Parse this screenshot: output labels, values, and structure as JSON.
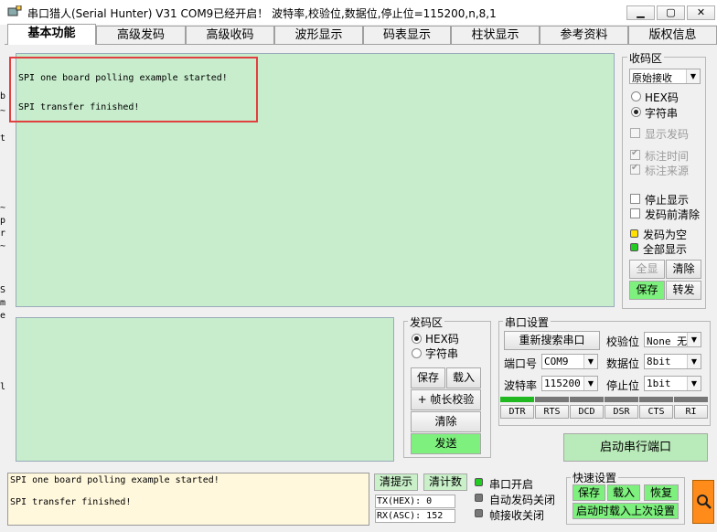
{
  "window": {
    "title": "串口猎人(Serial Hunter) V31    COM9已经开启！ 波特率,校验位,数据位,停止位=115200,n,8,1",
    "minimize": "▁",
    "maximize": "▢",
    "close": "✕"
  },
  "tabs": [
    "基本功能",
    "高级发码",
    "高级收码",
    "波形显示",
    "码表显示",
    "柱状显示",
    "参考资料",
    "版权信息"
  ],
  "receive": {
    "lines": [
      "SPI one board polling example started!",
      "SPI transfer finished!"
    ]
  },
  "left_edge_chars": [
    "b",
    "~",
    "t",
    "~",
    "p",
    "r",
    "~",
    "S",
    "m",
    "e",
    "l"
  ],
  "rx_panel": {
    "title": "收码区",
    "mode_value": "原始接收",
    "hex_label": "HEX码",
    "string_label": "字符串",
    "show_send_label": "显示发码",
    "mark_time_label": "标注时间",
    "mark_source_label": "标注来源",
    "stop_display_label": "停止显示",
    "clear_before_send_label": "发码前清除",
    "send_empty_label": "发码为空",
    "show_all_label": "全部显示",
    "all_button": "全显",
    "clear_button": "清除",
    "save_button": "保存",
    "switch_button": "转发"
  },
  "tx_panel": {
    "title": "发码区",
    "hex_label": "HEX码",
    "string_label": "字符串",
    "save_button": "保存",
    "load_button": "载入",
    "frame_check_button": "+ 帧长校验",
    "clear_button": "清除",
    "send_button": "发送"
  },
  "port_settings": {
    "title": "串口设置",
    "rescan_button": "重新搜索串口",
    "parity_label": "校验位",
    "parity_value": "None 无",
    "port_label": "端口号",
    "port_value": "COM9",
    "databits_label": "数据位",
    "databits_value": "8bit",
    "baud_label": "波特率",
    "baud_value": "115200",
    "stopbits_label": "停止位",
    "stopbits_value": "1bit",
    "pins": [
      "DTR",
      "RTS",
      "DCD",
      "DSR",
      "CTS",
      "RI"
    ],
    "start_button": "启动串行端口"
  },
  "bottom_log": {
    "lines": [
      "SPI one board polling example started!",
      "SPI transfer finished!"
    ]
  },
  "status": {
    "clear_hint_button": "清提示",
    "clear_count_button": "清计数",
    "tx_counter": "TX(HEX): 0",
    "rx_counter": "RX(ASC): 152",
    "port_open": "串口开启",
    "auto_send_off": "自动发码关闭",
    "frame_recv_off": "帧接收关闭"
  },
  "quick_settings": {
    "title": "快速设置",
    "save_button": "保存",
    "load_button": "载入",
    "restore_button": "恢复",
    "startup_load_button": "启动时载入上次设置"
  },
  "colors": {
    "receive_bg": "#c7edcc",
    "highlight_border": "#e04040",
    "send_button": "#7ef07e",
    "pin_bar_active": "#22b822",
    "led_green": "#22cc22",
    "led_yellow": "#ffe000"
  }
}
